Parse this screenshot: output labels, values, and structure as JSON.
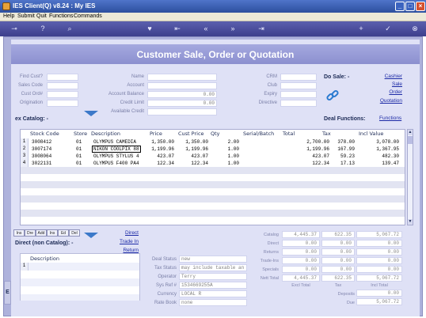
{
  "window": {
    "title": "IES Client(Q) v8.24 : My IES"
  },
  "menu": [
    "Help",
    "Submit",
    "Quit",
    "Functions",
    "Commands"
  ],
  "toolbar_icons": [
    "key-icon",
    "help-icon",
    "search-icon",
    "heart-icon",
    "first-icon",
    "prev-icon",
    "next-icon",
    "last-icon",
    "add-icon",
    "check-icon",
    "close-icon"
  ],
  "banner": {
    "title": "Customer Sale, Order or Quotation"
  },
  "form": {
    "left_labels": [
      "Find Cust?",
      "Sales Code",
      "Cust Ord#",
      "Origination"
    ],
    "mid_labels": [
      "Name",
      "Account",
      "Account Balance",
      "Credit Limit",
      "Available Credit"
    ],
    "mid_values": [
      "",
      "",
      "0.00",
      "0.00",
      ""
    ],
    "right_labels": [
      "CRM",
      "Club",
      "Expiry",
      "Directive"
    ],
    "do_sale_label": "Do Sale: -",
    "sale_links": [
      "Cashier",
      "Sale",
      "Order",
      "Quotation"
    ]
  },
  "catalog": {
    "title": "ex Catalog: -",
    "deal_functions_label": "Deal Functions:",
    "functions_link": "Functions",
    "columns": [
      "Stock Code",
      "Store",
      "Description",
      "Price",
      "Cust Price",
      "Qty",
      "Serial/Batch",
      "Total",
      "Tax",
      "Incl Value"
    ],
    "rows": [
      {
        "n": "1",
        "code": "3008412",
        "store": "01",
        "desc": "OLYMPUS CAMEDIA",
        "price": "1,350.00",
        "cust": "1,350.00",
        "qty": "2.00",
        "serial": "",
        "total": "2,700.00",
        "tax": "378.00",
        "incl": "3,078.00"
      },
      {
        "n": "2",
        "code": "3007174",
        "store": "01",
        "desc": "NIKON COOLPIX 88",
        "price": "1,199.96",
        "cust": "1,199.96",
        "qty": "1.00",
        "serial": "",
        "total": "1,199.96",
        "tax": "167.99",
        "incl": "1,367.95"
      },
      {
        "n": "3",
        "code": "3008064",
        "store": "01",
        "desc": "OLYMPUS STYLUS 4",
        "price": "423.07",
        "cust": "423.07",
        "qty": "1.00",
        "serial": "",
        "total": "423.07",
        "tax": "59.23",
        "incl": "482.30"
      },
      {
        "n": "4",
        "code": "3022131",
        "store": "01",
        "desc": "OLYMPUS F400 PA4",
        "price": "122.34",
        "cust": "122.34",
        "qty": "1.00",
        "serial": "",
        "total": "122.34",
        "tax": "17.13",
        "incl": "139.47"
      }
    ]
  },
  "tabs": [
    "Ins",
    "Dre",
    "Add",
    "Ins",
    "Ed",
    "Del"
  ],
  "direct_links": [
    "Direct",
    "Trade In",
    "Return"
  ],
  "non_catalog": {
    "title": "Direct (non Catalog): -",
    "column": "Description",
    "row_num": "1"
  },
  "deal": {
    "labels": [
      "Deal Status",
      "Tax Status",
      "Operator",
      "Sys Ref #",
      "Currency",
      "Rate Book"
    ],
    "values": [
      "new",
      "may include taxable an",
      "Terry",
      "1534669255A",
      "LOCAL R",
      "none"
    ]
  },
  "totals": {
    "labels": [
      "Catalog",
      "Direct",
      "Returns",
      "Trade-Ins",
      "Specials",
      "Nett Total"
    ],
    "rows": [
      [
        "4,445.37",
        "622.35",
        "5,067.72"
      ],
      [
        "0.00",
        "0.00",
        "0.00"
      ],
      [
        "0.00",
        "0.00",
        "0.00"
      ],
      [
        "0.00",
        "0.00",
        "0.00"
      ],
      [
        "0.00",
        "0.00",
        "0.00"
      ],
      [
        "4,445.37",
        "622.35",
        "5,067.72"
      ]
    ],
    "footer_labels": [
      "Excl Total",
      "Tax",
      "Incl Total"
    ],
    "deposits_label": "Deposits",
    "deposits_value": "0.00",
    "due_label": "Due",
    "due_value": "5,067.72"
  }
}
